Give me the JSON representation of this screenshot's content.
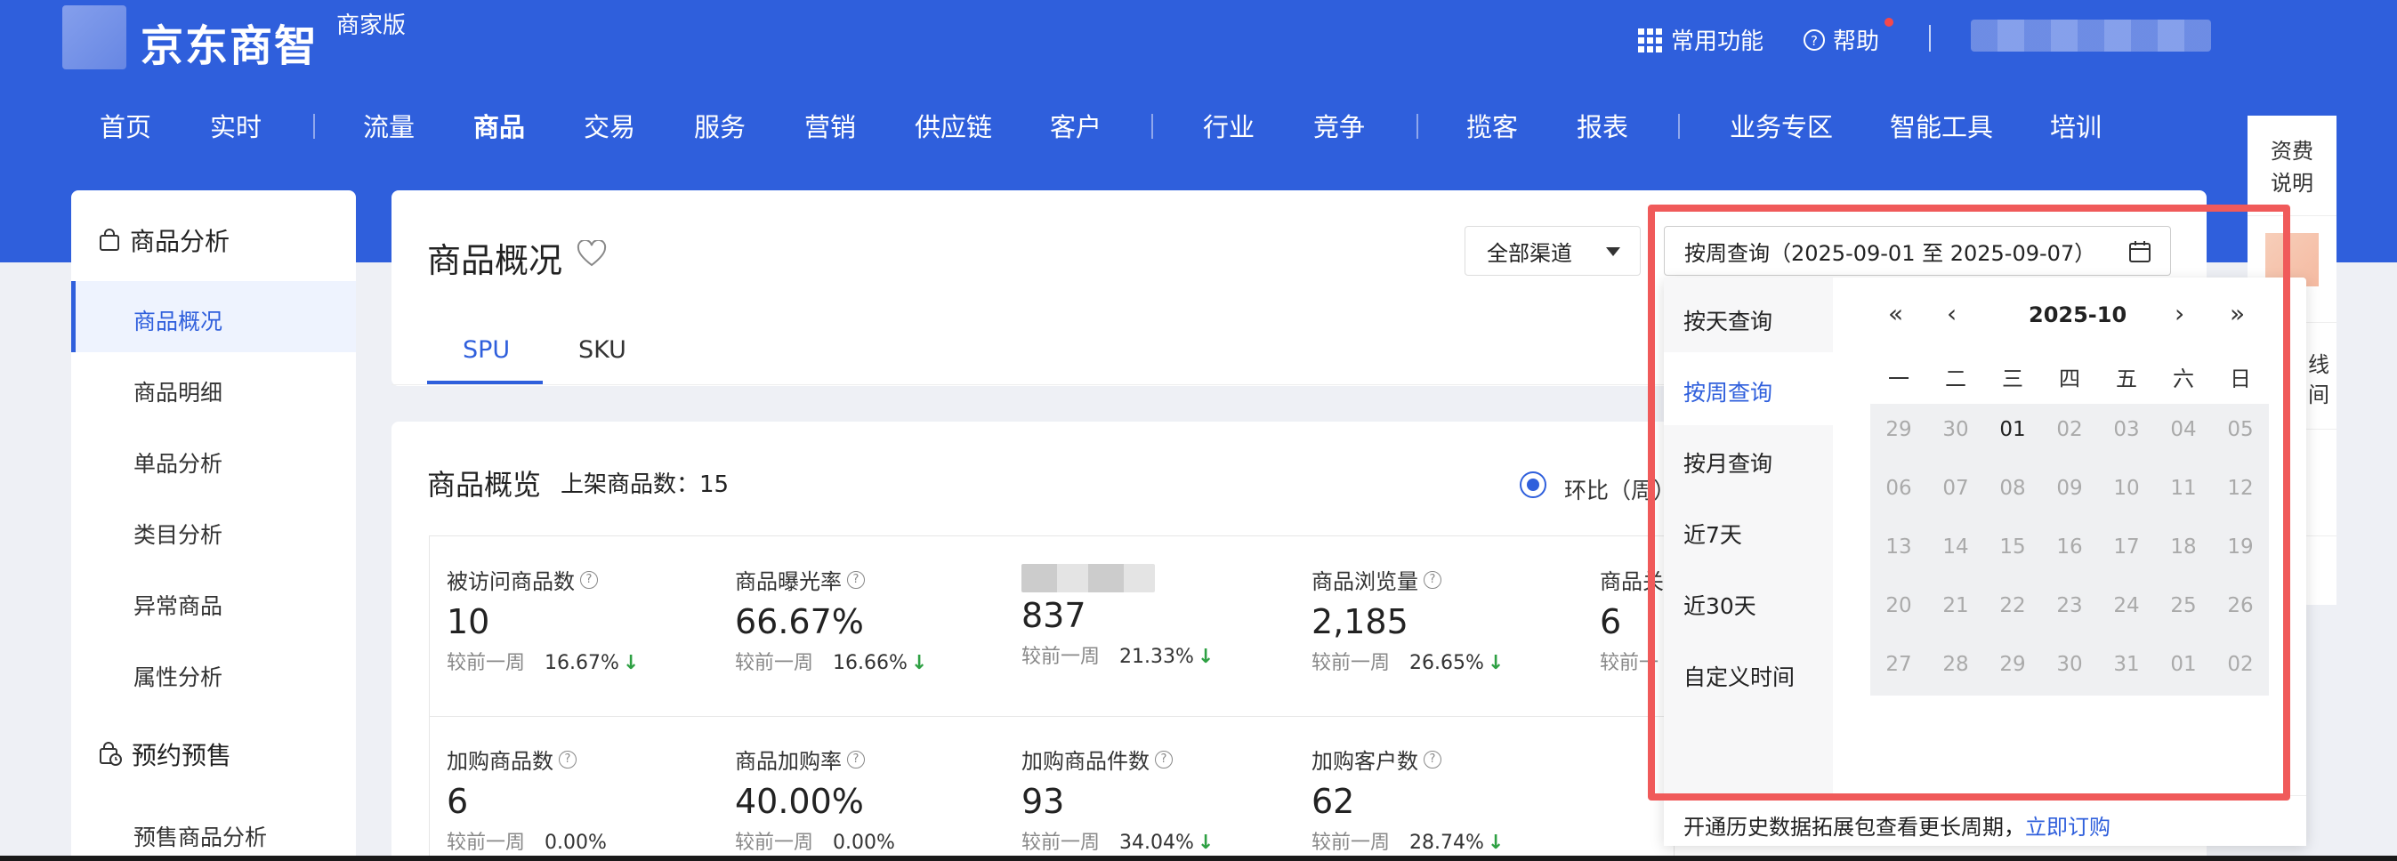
{
  "header": {
    "logo_text": "京东商智",
    "logo_sub": "商家版",
    "common_functions": "常用功能",
    "help": "帮助",
    "grid_icon": "grid-icon",
    "help_icon": "help-circle-icon"
  },
  "nav": {
    "items": [
      "首页",
      "实时",
      "流量",
      "商品",
      "交易",
      "服务",
      "营销",
      "供应链",
      "客户",
      "行业",
      "竞争",
      "揽客",
      "报表",
      "业务专区",
      "智能工具",
      "培训"
    ]
  },
  "sidebar": {
    "section1": "商品分析",
    "items1": [
      "商品概况",
      "商品明细",
      "单品分析",
      "类目分析",
      "异常商品",
      "属性分析"
    ],
    "section2": "预约预售",
    "items2": [
      "预售商品分析"
    ]
  },
  "page": {
    "title": "商品概况",
    "tabs": [
      "SPU",
      "SKU"
    ],
    "channel": "全部渠道",
    "date_range": "按周查询（2025-09-01 至 2025-09-07）"
  },
  "overview": {
    "title": "商品概览",
    "count_label": "上架商品数：15",
    "radio_label": "环比（周）"
  },
  "metrics": [
    {
      "label": "被访问商品数",
      "value": "10",
      "cmp": "较前一周",
      "pct": "16.67%",
      "arrow": "↓"
    },
    {
      "label": "商品曝光率",
      "value": "66.67%",
      "cmp": "较前一周",
      "pct": "16.66%",
      "arrow": "↓"
    },
    {
      "label": "",
      "value": "837",
      "cmp": "较前一周",
      "pct": "21.33%",
      "arrow": "↓"
    },
    {
      "label": "商品浏览量",
      "value": "2,185",
      "cmp": "较前一周",
      "pct": "26.65%",
      "arrow": "↓"
    },
    {
      "label": "商品关",
      "value": "6",
      "cmp": "较前一",
      "pct": "",
      "arrow": ""
    },
    {
      "label": "加购商品数",
      "value": "6",
      "cmp": "较前一周",
      "pct": "0.00%",
      "arrow": ""
    },
    {
      "label": "商品加购率",
      "value": "40.00%",
      "cmp": "较前一周",
      "pct": "0.00%",
      "arrow": ""
    },
    {
      "label": "加购商品件数",
      "value": "93",
      "cmp": "较前一周",
      "pct": "34.04%",
      "arrow": "↓"
    },
    {
      "label": "加购客户数",
      "value": "62",
      "cmp": "较前一周",
      "pct": "28.74%",
      "arrow": "↓"
    }
  ],
  "right_rail": {
    "text": "资费说明",
    "frag1": "线",
    "frag2": "间"
  },
  "date_picker": {
    "options": [
      "按天查询",
      "按周查询",
      "按月查询",
      "近7天",
      "近30天",
      "自定义时间"
    ],
    "selected": "按周查询",
    "month": "2025-10",
    "weekdays": [
      "一",
      "二",
      "三",
      "四",
      "五",
      "六",
      "日"
    ],
    "weeks": [
      [
        "29",
        "30",
        "01",
        "02",
        "03",
        "04",
        "05"
      ],
      [
        "06",
        "07",
        "08",
        "09",
        "10",
        "11",
        "12"
      ],
      [
        "13",
        "14",
        "15",
        "16",
        "17",
        "18",
        "19"
      ],
      [
        "20",
        "21",
        "22",
        "23",
        "24",
        "25",
        "26"
      ],
      [
        "27",
        "28",
        "29",
        "30",
        "31",
        "01",
        "02"
      ]
    ],
    "footer_text": "开通历史数据拓展包查看更长周期，",
    "footer_link": "立即订购"
  }
}
